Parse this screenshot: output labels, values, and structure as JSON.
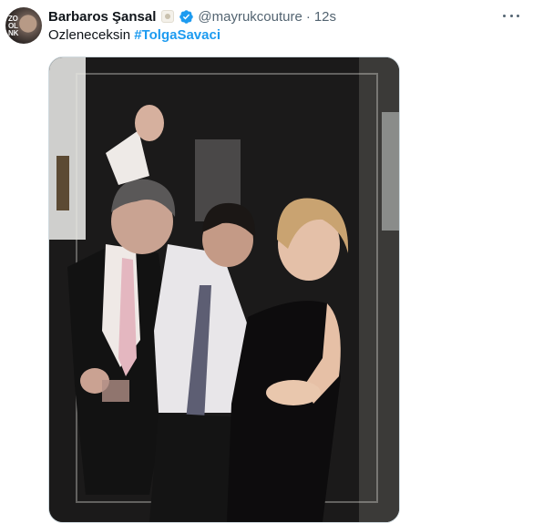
{
  "tweet": {
    "display_name": "Barbaros Şansal",
    "handle": "@mayrukcouture",
    "separator": "·",
    "time": "12s",
    "text_plain": "Ozleneceksin ",
    "hashtag": "#TolgaSavaci"
  },
  "avatar": {
    "overlay_text_1": "ZO",
    "overlay_text_2": "OL",
    "overlay_text_3": "NK"
  },
  "icons": {
    "affiliation": "affiliation-badge-icon",
    "verified": "verified-badge-icon",
    "more": "more-options-icon"
  },
  "colors": {
    "text_primary": "#0f1419",
    "text_secondary": "#536471",
    "accent": "#1d9bf0"
  }
}
